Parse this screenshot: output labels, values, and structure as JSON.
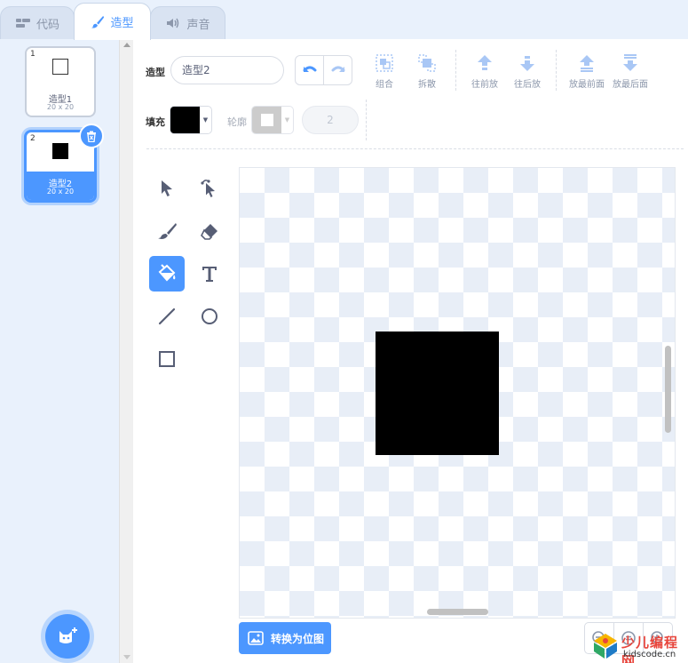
{
  "tabs": [
    {
      "label": "代码",
      "icon": "code-icon"
    },
    {
      "label": "造型",
      "icon": "brush-icon"
    },
    {
      "label": "声音",
      "icon": "speaker-icon"
    }
  ],
  "costumes": [
    {
      "index": "1",
      "name": "造型1",
      "size": "20 x 20",
      "selected": false
    },
    {
      "index": "2",
      "name": "造型2",
      "size": "20 x 20",
      "selected": true
    }
  ],
  "toolbar": {
    "costume_label": "造型",
    "costume_name": "造型2",
    "group": "组合",
    "ungroup": "拆散",
    "forward": "往前放",
    "backward": "往后放",
    "front": "放最前面",
    "back": "放最后面"
  },
  "fill": {
    "label": "填充",
    "color": "#000000"
  },
  "outline": {
    "label": "轮廓",
    "color": "#ffffff",
    "width": "2"
  },
  "tools": [
    "select",
    "reshape",
    "brush",
    "eraser",
    "fill",
    "text",
    "line",
    "circle",
    "rect"
  ],
  "active_tool": "fill",
  "bitmap_button": "转换为位图",
  "watermark": {
    "brand": "少儿编程网",
    "url": "kidscode.cn"
  },
  "colors": {
    "accent": "#4c97ff",
    "shape": "#000000"
  }
}
